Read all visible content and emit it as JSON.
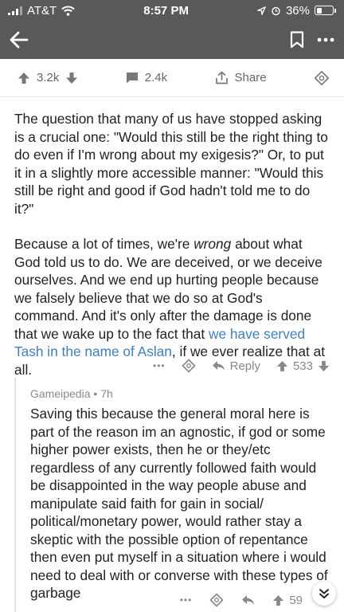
{
  "status": {
    "carrier": "AT&T",
    "time": "8:57 PM",
    "battery": "36%",
    "battery_level": 0.36
  },
  "post": {
    "upvotes": "3.2k",
    "comments": "2.4k",
    "share_label": "Share"
  },
  "comment": {
    "paragraph1": "The question that many of us have stopped asking is a crucial one: \"Would this still be the right thing to do even if I'm wrong about my exigesis?\" Or, to put it in a slightly more accessible manner: \"Would this still be right and good if God hadn't told me to do it?\"",
    "p2_part1": "Because a lot of times, we're ",
    "p2_emph": "wrong",
    "p2_part2": " about what God told us to do. We are deceived, or we deceive ourselves. And we end up hurting people because we falsely believe that we do so at God's command. And it's only after the damage is done that we wake up to the fact that ",
    "p2_link": "we have served Tash in the name of Aslan",
    "p2_part3": ", if we ever realize that at all.",
    "more": "•••",
    "reply_label": "Reply",
    "score": "533"
  },
  "reply": {
    "author": "Gameipedia",
    "time": "7h",
    "body": "Saving this because the general moral here is part of the reason im an agnostic, if god or some higher power exists, then he or they/etc regardless of any currently followed faith would be disappointed in the way people abuse and manipulate said faith for gain in social/ political/monetary power, would rather stay a skeptic with the possible option of repentance then even put myself in a situation where i would need to deal with or converse with these types of garbage",
    "more": "•••",
    "score": "59"
  },
  "colors": {
    "bar": "#58595b",
    "link": "#3f7fbf"
  }
}
